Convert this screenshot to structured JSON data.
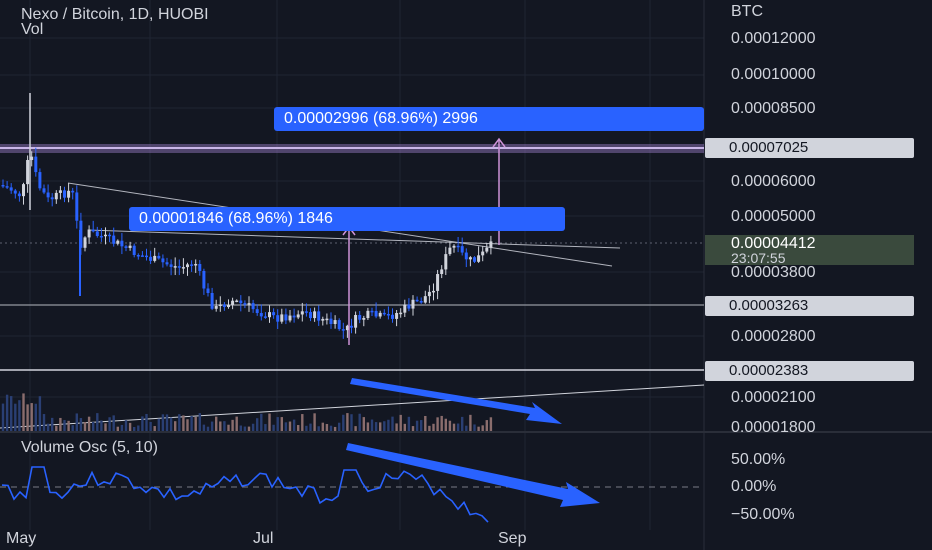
{
  "header": {
    "title": "Nexo / Bitcoin, 1D, HUOBI",
    "vol_label": "Vol"
  },
  "price_axis": {
    "currency": "BTC",
    "ticks": [
      "0.00012000",
      "0.00010000",
      "0.00008500",
      "0.00006000",
      "0.00005000",
      "0.00003800",
      "0.00002800",
      "0.00002100",
      "0.00001800"
    ],
    "levels": [
      "0.00007025",
      "0.00003263",
      "0.00002383"
    ],
    "current_price": "0.00004412",
    "countdown": "23:07:55"
  },
  "measurements": [
    {
      "text": "0.00001846 (68.96%) 1846"
    },
    {
      "text": "0.00002996 (68.96%) 2996"
    }
  ],
  "oscillator": {
    "label": "Volume Osc (5, 10)",
    "ticks": [
      "50.00%",
      "0.00%",
      "−50.00%"
    ]
  },
  "time_axis": {
    "labels": [
      "May",
      "Jul",
      "Sep"
    ]
  },
  "colors": {
    "background": "#131722",
    "up": "#d1d4dc",
    "down": "#2962ff",
    "annotation_arrow": "#2962ff",
    "resistance_band": "#b39ddb",
    "measure_arrow": "#ce93d8"
  }
}
